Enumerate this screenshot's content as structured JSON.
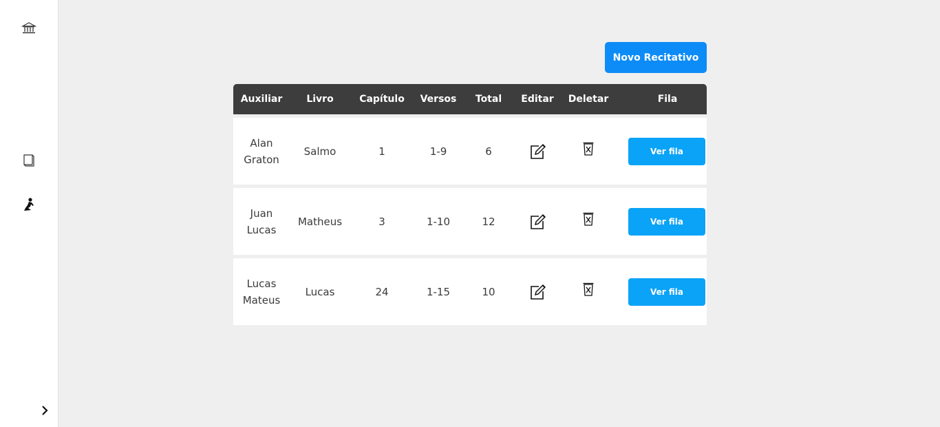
{
  "sidebar": {
    "icons": [
      "temple-icon",
      "book-icon",
      "praying-person-icon"
    ],
    "expand_icon": "chevron-right-icon"
  },
  "actions": {
    "new_label": "Novo Recitativo"
  },
  "table": {
    "headers": [
      "Auxiliar",
      "Livro",
      "Capítulo",
      "Versos",
      "Total",
      "Editar",
      "Deletar",
      "Fila"
    ],
    "rows": [
      {
        "auxiliar": "Alan Graton",
        "livro": "Salmo",
        "capitulo": "1",
        "versos": "1-9",
        "total": "6",
        "action_label": "Ver fila"
      },
      {
        "auxiliar": "Juan Lucas",
        "livro": "Matheus",
        "capitulo": "3",
        "versos": "1-10",
        "total": "12",
        "action_label": "Ver fila"
      },
      {
        "auxiliar": "Lucas Mateus",
        "livro": "Lucas",
        "capitulo": "24",
        "versos": "1-15",
        "total": "10",
        "action_label": "Ver fila"
      }
    ]
  },
  "colors": {
    "header_bg": "#3d3d3d",
    "primary": "#0d8cf7",
    "row_button": "#0ba3f7"
  }
}
